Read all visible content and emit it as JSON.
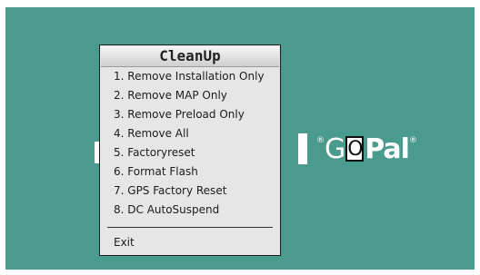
{
  "background": {
    "color": "#4a9a8d"
  },
  "logo": {
    "prefix": "G",
    "cursor_char": "O",
    "suffix": "Pal",
    "mark": "®"
  },
  "menu": {
    "title": "CleanUp",
    "items": [
      "1. Remove Installation Only",
      "2. Remove MAP Only",
      "3. Remove Preload Only",
      "4. Remove All",
      "5. Factoryreset",
      "6. Format Flash",
      "7. GPS Factory Reset",
      "8. DC AutoSuspend"
    ],
    "exit": "Exit"
  }
}
